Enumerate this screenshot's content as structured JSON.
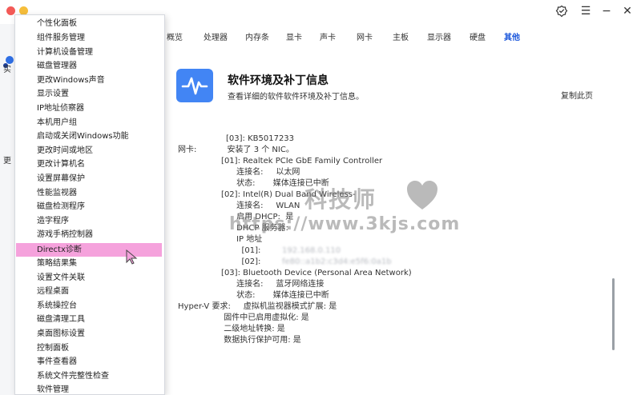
{
  "window": {
    "controls": [
      "✓",
      "☰",
      "−"
    ],
    "close_label": "✕"
  },
  "sidebar_fragments": [
    "实",
    "更"
  ],
  "nav": {
    "tabs": [
      "概览",
      "处理器",
      "内存条",
      "显卡",
      "声卡",
      "网卡",
      "主板",
      "显示器",
      "硬盘",
      "其他"
    ],
    "active_index": 9
  },
  "info": {
    "title": "软件环境及补丁信息",
    "subtitle": "查看详细的软件软件环境及补丁信息。",
    "copy_label": "复制此页"
  },
  "detail_lines": [
    "[03]: KB5017233",
    "网卡:            安装了 3 个 NIC。",
    "                 [01]: Realtek PCIe GbE Family Controller",
    "                       连接名:     以太网",
    "                       状态:       媒体连接已中断",
    "                 [02]: Intel(R) Dual Band Wireless-",
    "                       连接名:     WLAN",
    "                       启用 DHCP:  是",
    "                       DHCP 服务器:",
    "                       IP 地址",
    "                         [01]:",
    "                         [02]:",
    "                 [03]: Bluetooth Device (Personal Area Network)",
    "                       连接名:     蓝牙网络连接",
    "                       状态:       媒体连接已中断",
    "Hyper-V 要求:     虚拟机监视器模式扩展: 是",
    "                  固件中已启用虚拟化: 是",
    "                  二级地址转换: 是",
    "                  数据执行保护可用: 是"
  ],
  "watermark": {
    "name": "科技师",
    "url": "https://www.3kjs.com"
  },
  "menu": {
    "items": [
      "个性化面板",
      "组件服务管理",
      "计算机设备管理",
      "磁盘管理器",
      "更改Windows声音",
      "显示设置",
      "IP地址侦察器",
      "本机用户组",
      "启动或关闭Windows功能",
      "更改时间或地区",
      "更改计算机名",
      "设置屏幕保护",
      "性能监视器",
      "磁盘检测程序",
      "造字程序",
      "游戏手柄控制器",
      "Directx诊断",
      "策略结果集",
      "设置文件关联",
      "远程桌面",
      "系统操控台",
      "磁盘清理工具",
      "桌面图标设置",
      "控制面板",
      "事件查看器",
      "系统文件完整性检查",
      "软件管理"
    ],
    "selected_index": 16
  },
  "colors": {
    "accent": "#1a56db",
    "icon_bg": "#4285f4",
    "selected_bg": "#f5a2dc"
  }
}
